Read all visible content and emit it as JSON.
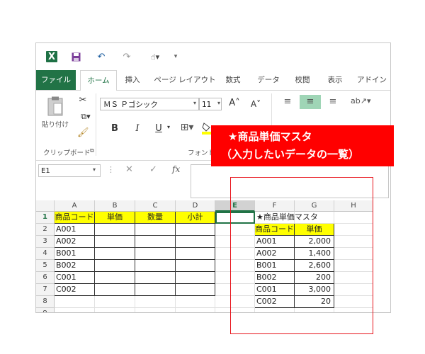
{
  "tabs": [
    {
      "label": "ファイル"
    },
    {
      "label": "ホーム"
    },
    {
      "label": "挿入"
    },
    {
      "label": "ページ レイアウト"
    },
    {
      "label": "数式"
    },
    {
      "label": "データ"
    },
    {
      "label": "校閲"
    },
    {
      "label": "表示"
    },
    {
      "label": "アドイン"
    }
  ],
  "ribbon": {
    "paste_label": "貼り付け",
    "clipboard_label": "クリップボード",
    "font_label": "フォント",
    "font_name": "ＭＳ Ｐゴシック",
    "font_size": "11",
    "bold": "B",
    "italic": "I",
    "underline": "U"
  },
  "formula_bar": {
    "name_box": "E1",
    "fx": "fx"
  },
  "columns": [
    "A",
    "B",
    "C",
    "D",
    "E",
    "F",
    "G",
    "H"
  ],
  "rows": [
    "1",
    "2",
    "3",
    "4",
    "5",
    "6",
    "7",
    "8",
    "9"
  ],
  "selected_cell": "E1",
  "table1": {
    "headers": [
      "商品コード",
      "単価",
      "数量",
      "小計"
    ],
    "codes": [
      "A001",
      "A002",
      "B001",
      "B002",
      "C001",
      "C002"
    ]
  },
  "master": {
    "title": "★商品単価マスタ",
    "headers": [
      "商品コード",
      "単価"
    ],
    "rows": [
      {
        "code": "A001",
        "price": "2,000"
      },
      {
        "code": "A002",
        "price": "1,400"
      },
      {
        "code": "B001",
        "price": "2,600"
      },
      {
        "code": "B002",
        "price": "200"
      },
      {
        "code": "C001",
        "price": "3,000"
      },
      {
        "code": "C002",
        "price": "20"
      }
    ]
  },
  "callout": {
    "line1": "★商品単価マスタ",
    "line2": "（入力したいデータの一覧）"
  },
  "colors": {
    "excel_green": "#217346",
    "highlight": "#ffff00",
    "callout_red": "#ff0000"
  }
}
